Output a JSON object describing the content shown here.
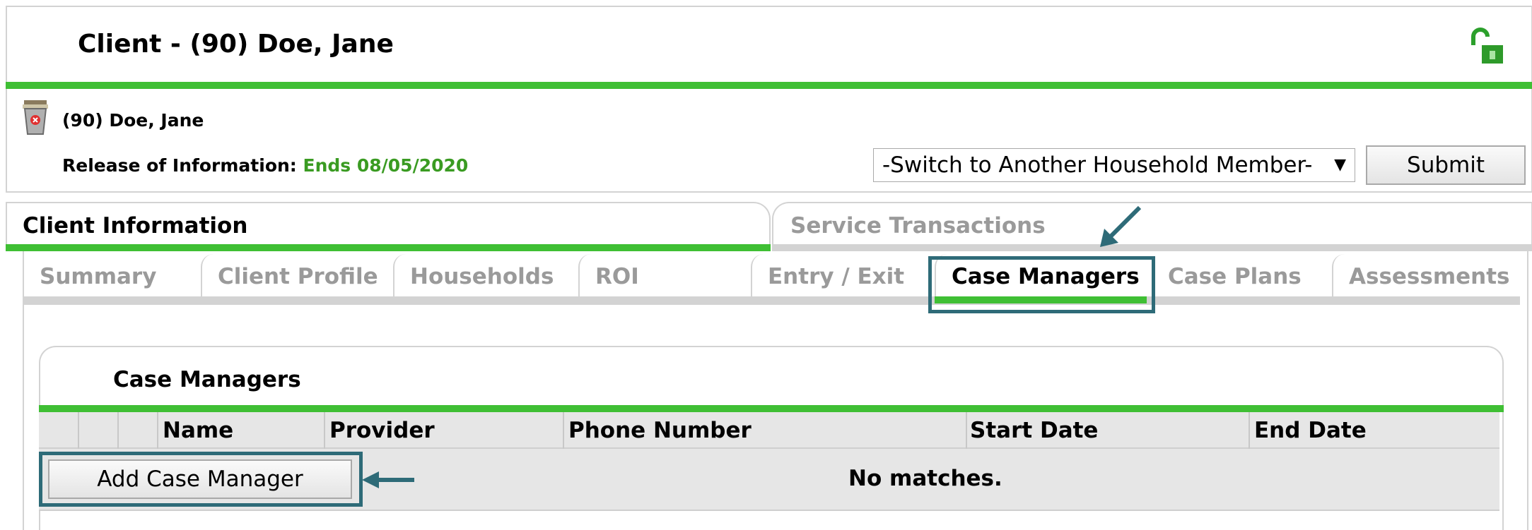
{
  "header": {
    "title": "Client - (90) Doe, Jane",
    "client_name": "(90) Doe, Jane",
    "roi_label": "Release of Information:",
    "roi_value": "Ends 08/05/2020",
    "household_select": "-Switch to Another Household Member-",
    "submit_label": "Submit",
    "lock_icon": "unlocked-padlock-icon",
    "trash_icon": "trash-can-icon"
  },
  "top_tabs": [
    {
      "label": "Client Information",
      "active": true
    },
    {
      "label": "Service Transactions",
      "active": false
    }
  ],
  "sub_tabs": [
    {
      "label": "Summary"
    },
    {
      "label": "Client Profile"
    },
    {
      "label": "Households"
    },
    {
      "label": "ROI"
    },
    {
      "label": "Entry / Exit"
    },
    {
      "label": "Case Managers",
      "active": true
    },
    {
      "label": "Case Plans"
    },
    {
      "label": "Assessments"
    }
  ],
  "case_managers": {
    "title": "Case Managers",
    "columns": [
      "Name",
      "Provider",
      "Phone Number",
      "Start Date",
      "End Date"
    ],
    "add_button": "Add Case Manager",
    "empty_text": "No matches."
  },
  "colors": {
    "accent_green": "#3fbf34",
    "highlight": "#2e6b78",
    "roi_green": "#3a9b22"
  }
}
